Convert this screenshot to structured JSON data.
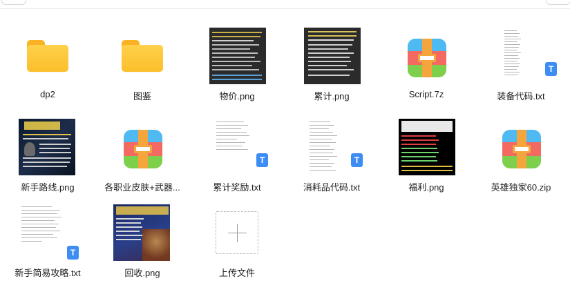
{
  "files": [
    {
      "name": "dp2",
      "type": "folder"
    },
    {
      "name": "图鉴",
      "type": "folder"
    },
    {
      "name": "物价.png",
      "type": "image"
    },
    {
      "name": "累计.png",
      "type": "image"
    },
    {
      "name": "Script.7z",
      "type": "archive"
    },
    {
      "name": "装备代码.txt",
      "type": "text"
    },
    {
      "name": "新手路线.png",
      "type": "image"
    },
    {
      "name": "各职业皮肤+武器...",
      "type": "archive"
    },
    {
      "name": "累计奖励.txt",
      "type": "text"
    },
    {
      "name": "消耗品代码.txt",
      "type": "text"
    },
    {
      "name": "福利.png",
      "type": "image"
    },
    {
      "name": "英雄独家60.zip",
      "type": "archive"
    },
    {
      "name": "新手简易攻略.txt",
      "type": "text"
    },
    {
      "name": "回收.png",
      "type": "image"
    }
  ],
  "upload": {
    "label": "上传文件"
  },
  "txt_badge": "T",
  "colors": {
    "folder": "#fbbf2a",
    "txt_badge": "#3d8df5",
    "archive_red": "#f36a62",
    "archive_blue": "#4fb9f2",
    "archive_green": "#7ed04c",
    "archive_strap": "#f4a53b"
  },
  "icons": {
    "folder": "folder-icon",
    "archive": "archive-icon",
    "text": "text-file-icon",
    "image": "image-thumbnail",
    "upload": "plus-icon"
  }
}
